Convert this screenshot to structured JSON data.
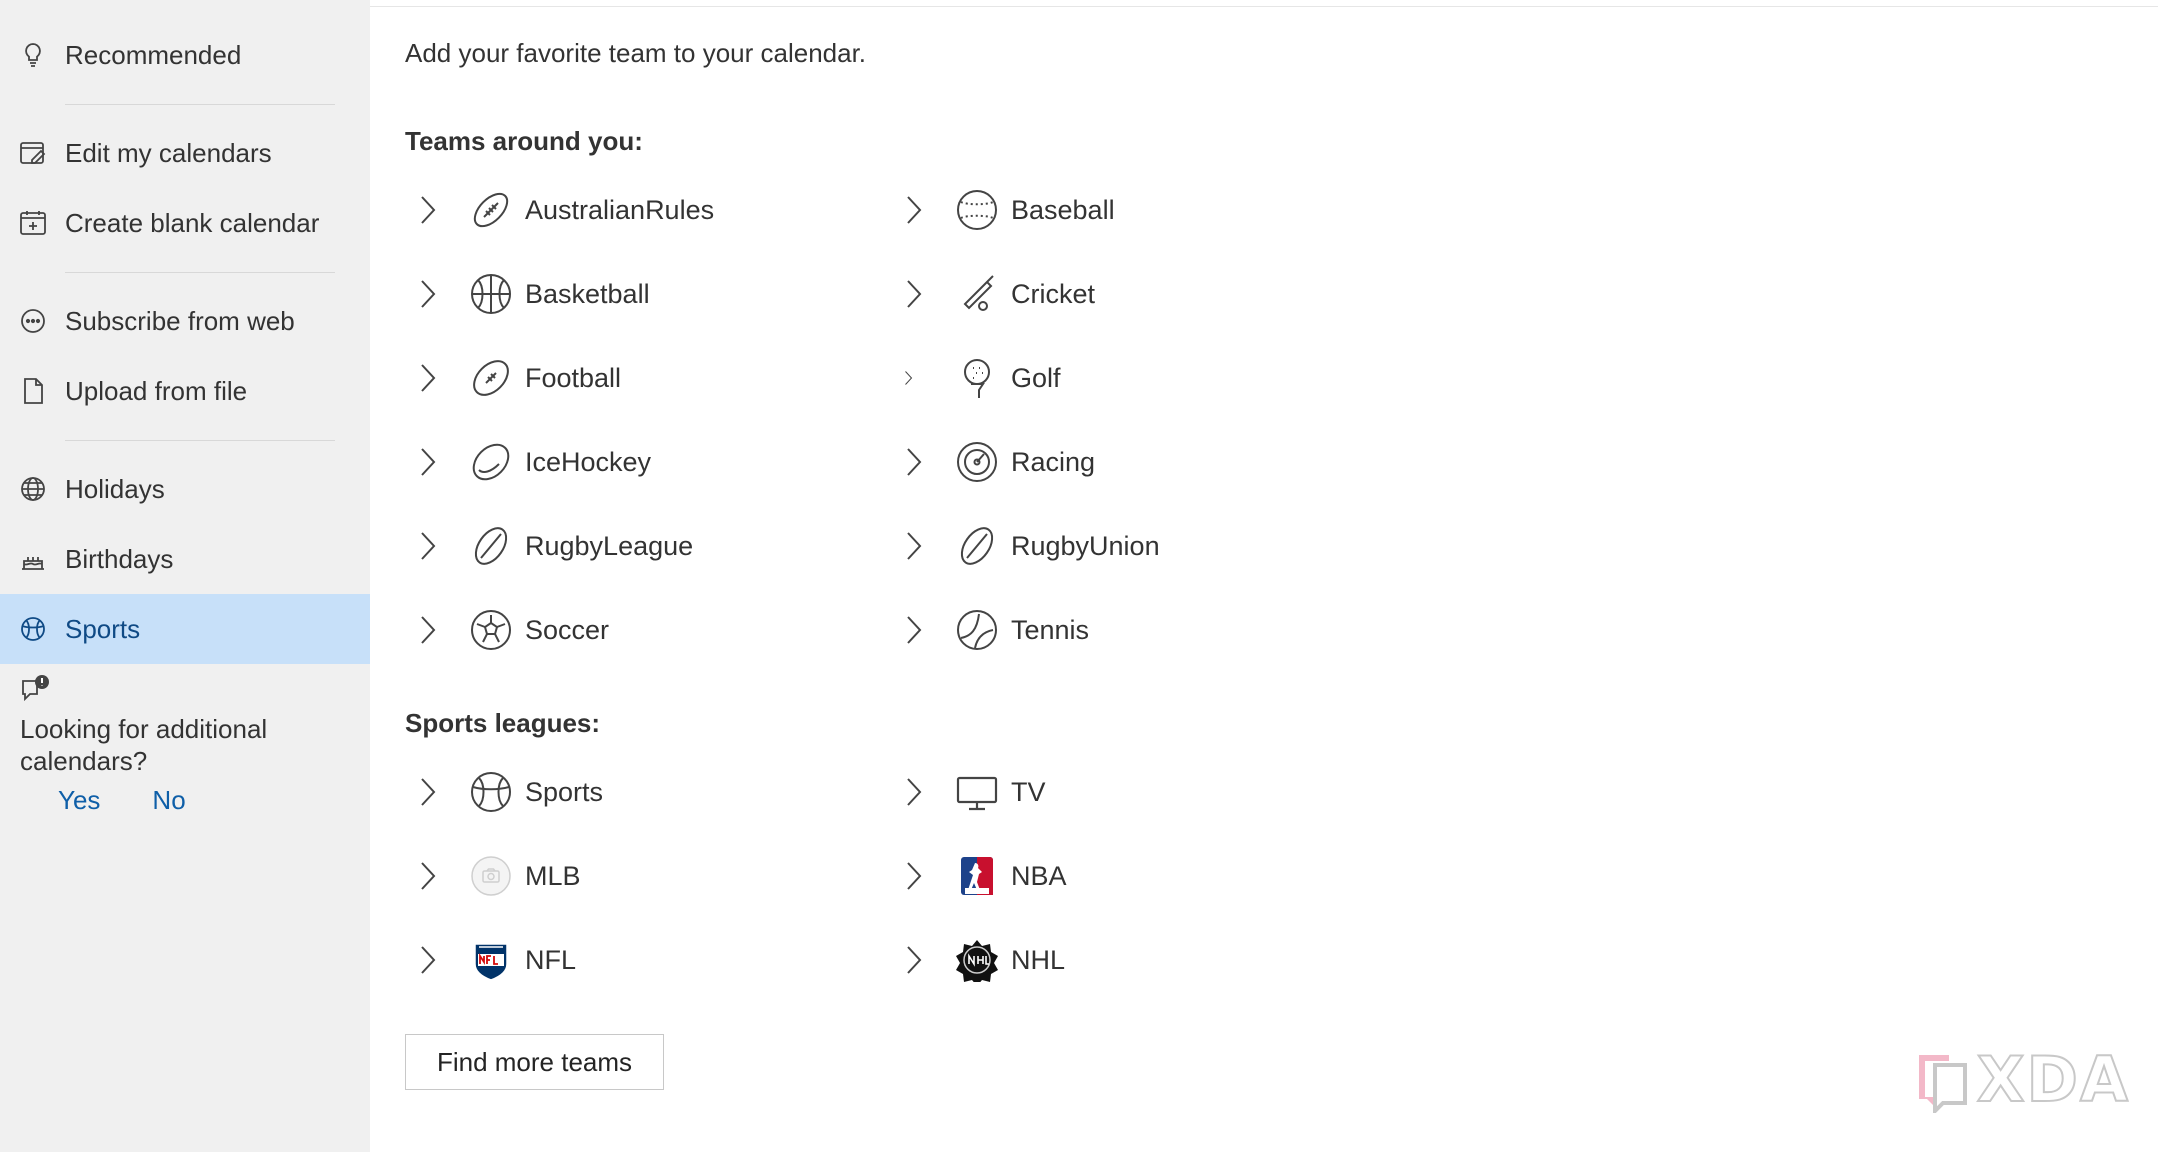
{
  "sidebar": {
    "items": [
      {
        "label": "Recommended",
        "icon": "lightbulb-icon"
      },
      {
        "label": "Edit my calendars",
        "icon": "edit-calendar-icon"
      },
      {
        "label": "Create blank calendar",
        "icon": "calendar-add-icon"
      },
      {
        "label": "Subscribe from web",
        "icon": "link-icon"
      },
      {
        "label": "Upload from file",
        "icon": "document-icon"
      },
      {
        "label": "Holidays",
        "icon": "globe-icon"
      },
      {
        "label": "Birthdays",
        "icon": "cake-icon"
      },
      {
        "label": "Sports",
        "icon": "sports-icon",
        "selected": true
      }
    ],
    "feedback": {
      "question": "Looking for additional calendars?",
      "yes": "Yes",
      "no": "No"
    }
  },
  "main": {
    "intro": "Add your favorite team to your calendar.",
    "teams_title": "Teams around you:",
    "teams": [
      {
        "name": "AustralianRules",
        "icon": "australian-rules-icon"
      },
      {
        "name": "Baseball",
        "icon": "baseball-icon"
      },
      {
        "name": "Basketball",
        "icon": "basketball-icon"
      },
      {
        "name": "Cricket",
        "icon": "cricket-icon"
      },
      {
        "name": "Football",
        "icon": "football-icon"
      },
      {
        "name": "Golf",
        "icon": "golf-icon"
      },
      {
        "name": "IceHockey",
        "icon": "ice-hockey-icon"
      },
      {
        "name": "Racing",
        "icon": "racing-icon"
      },
      {
        "name": "RugbyLeague",
        "icon": "rugby-league-icon"
      },
      {
        "name": "RugbyUnion",
        "icon": "rugby-union-icon"
      },
      {
        "name": "Soccer",
        "icon": "soccer-icon"
      },
      {
        "name": "Tennis",
        "icon": "tennis-icon"
      }
    ],
    "leagues_title": "Sports leagues:",
    "leagues": [
      {
        "name": "Sports",
        "icon": "sports-icon"
      },
      {
        "name": "TV",
        "icon": "tv-icon"
      },
      {
        "name": "MLB",
        "icon": "mlb-placeholder-icon"
      },
      {
        "name": "NBA",
        "icon": "nba-logo-icon"
      },
      {
        "name": "NFL",
        "icon": "nfl-logo-icon"
      },
      {
        "name": "NHL",
        "icon": "nhl-logo-icon"
      }
    ],
    "find_more_label": "Find more teams"
  },
  "watermark": {
    "text": "XDA",
    "icon": "xda-logo-icon"
  },
  "colors": {
    "sidebar_bg": "#f0f0f0",
    "selected_bg": "#c7e0f9",
    "selected_text": "#0f4a85",
    "link": "#0f5fa8"
  }
}
